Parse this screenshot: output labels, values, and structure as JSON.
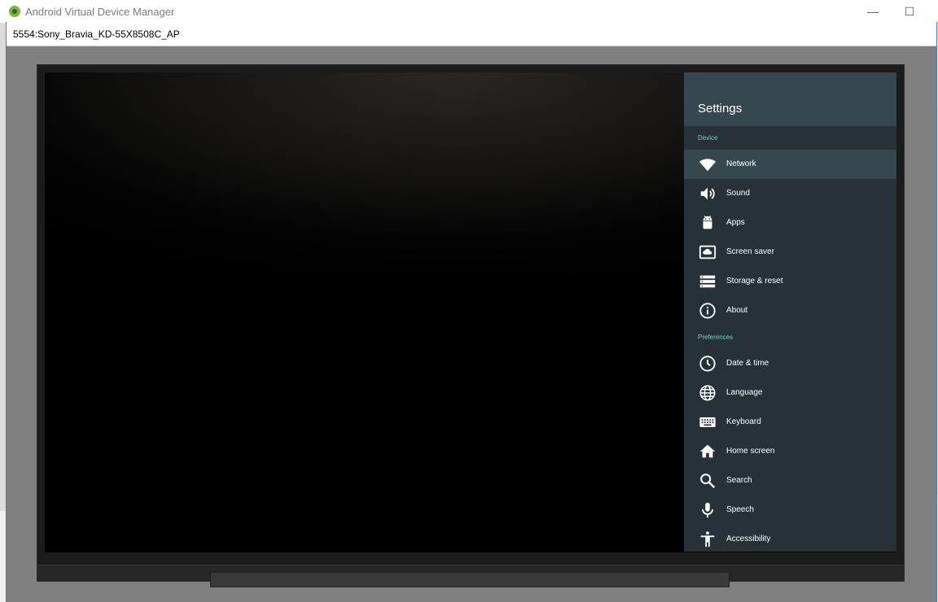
{
  "background_window": {
    "title": "Android Virtual Device Manager",
    "minimize_label": "—",
    "maximize_label": "☐"
  },
  "emulator": {
    "title": "5554:Sony_Bravia_KD-55X8508C_AP"
  },
  "settings": {
    "title": "Settings",
    "sections": [
      {
        "label": "Device",
        "items": [
          {
            "label": "Network",
            "icon": "wifi-icon",
            "selected": true
          },
          {
            "label": "Sound",
            "icon": "volume-icon",
            "selected": false
          },
          {
            "label": "Apps",
            "icon": "android-icon",
            "selected": false
          },
          {
            "label": "Screen saver",
            "icon": "screen-saver-icon",
            "selected": false
          },
          {
            "label": "Storage & reset",
            "icon": "storage-icon",
            "selected": false
          },
          {
            "label": "About",
            "icon": "info-icon",
            "selected": false
          }
        ]
      },
      {
        "label": "Preferences",
        "items": [
          {
            "label": "Date & time",
            "icon": "clock-icon",
            "selected": false
          },
          {
            "label": "Language",
            "icon": "globe-icon",
            "selected": false
          },
          {
            "label": "Keyboard",
            "icon": "keyboard-icon",
            "selected": false
          },
          {
            "label": "Home screen",
            "icon": "home-icon",
            "selected": false
          },
          {
            "label": "Search",
            "icon": "search-icon",
            "selected": false
          },
          {
            "label": "Speech",
            "icon": "microphone-icon",
            "selected": false
          },
          {
            "label": "Accessibility",
            "icon": "accessibility-icon",
            "selected": false
          }
        ]
      }
    ]
  },
  "colors": {
    "settings_bg": "#263238",
    "settings_header": "#37474f",
    "section_accent": "#80cbc4"
  }
}
